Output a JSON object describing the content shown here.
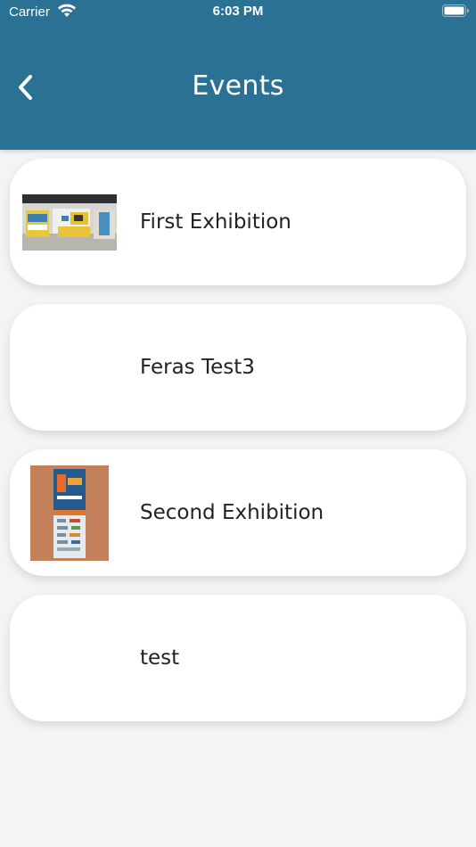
{
  "status_bar": {
    "carrier": "Carrier",
    "time": "6:03 PM"
  },
  "header": {
    "title": "Events",
    "back_icon": "chevron-left-icon",
    "background_color": "#2a7193"
  },
  "events": [
    {
      "name": "First Exhibition",
      "has_image": true,
      "image": "exhibition-booth-photo"
    },
    {
      "name": "Feras Test3",
      "has_image": false
    },
    {
      "name": "Second Exhibition",
      "has_image": true,
      "image": "exhibition-banner-photo"
    },
    {
      "name": "test",
      "has_image": false
    }
  ]
}
